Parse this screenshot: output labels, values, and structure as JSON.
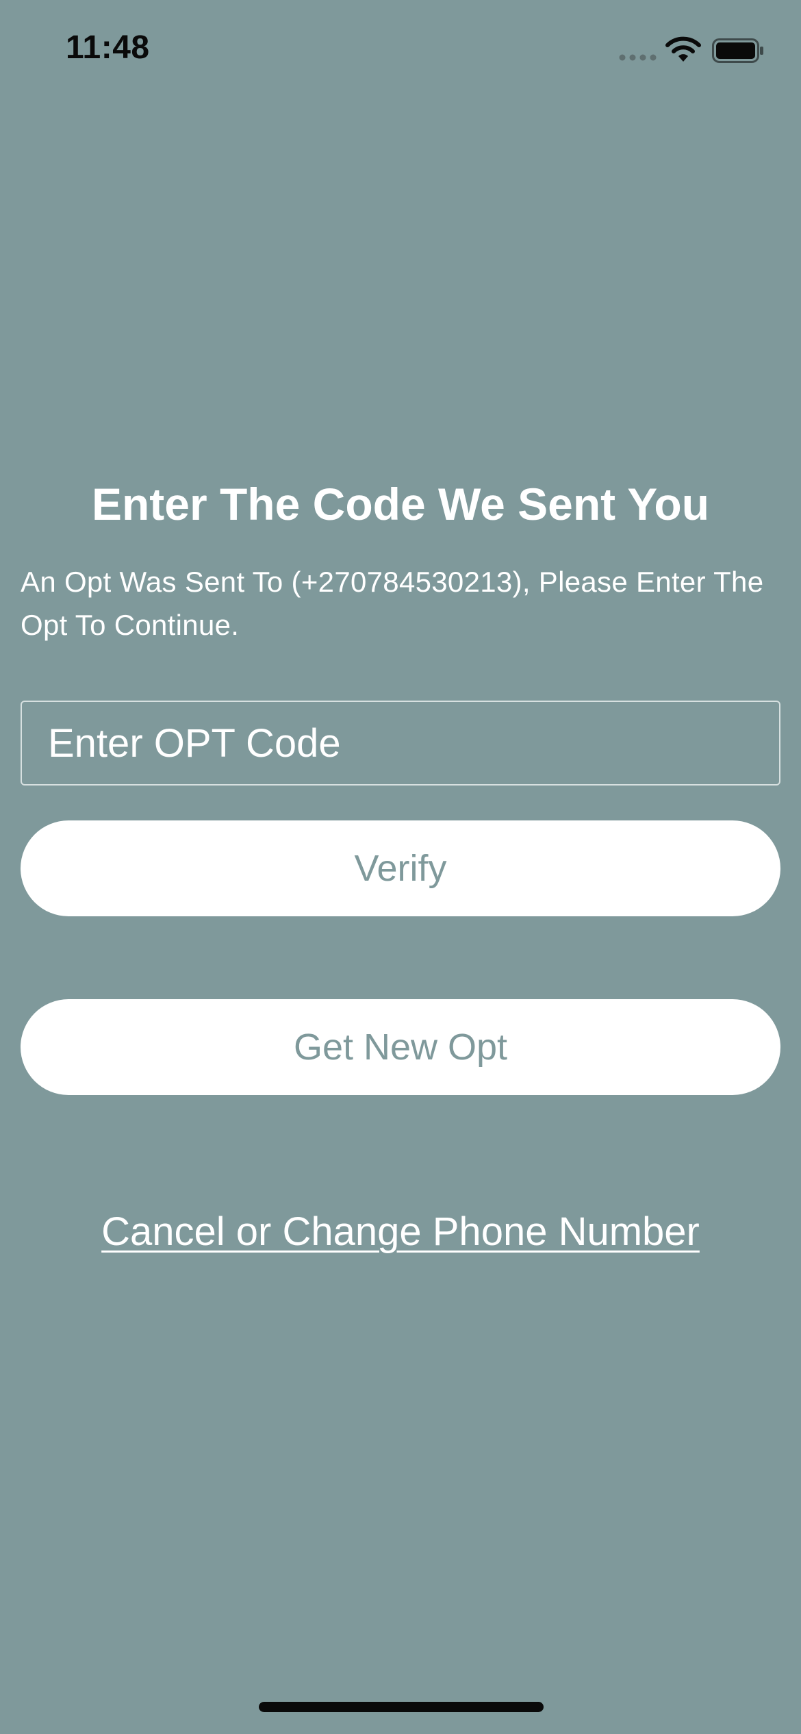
{
  "status_bar": {
    "time": "11:48",
    "icons": [
      "cellular-signal-icon",
      "wifi-icon",
      "battery-icon"
    ]
  },
  "otp_screen": {
    "title": "Enter The Code We Sent You",
    "description": "An Opt Was Sent To (+270784530213), Please Enter The Opt To Continue.",
    "code_input": {
      "placeholder": "Enter OPT Code",
      "value": ""
    },
    "verify_label": "Verify",
    "new_code_label": "Get New Opt",
    "cancel_label": "Cancel or Change Phone Number"
  },
  "colors": {
    "background": "#7f999b",
    "button_background": "#ffffff",
    "button_text": "#7f999b",
    "text": "#ffffff"
  }
}
